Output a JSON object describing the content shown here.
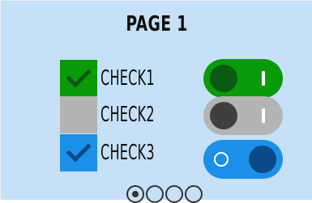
{
  "page": {
    "title": "PAGE 1"
  },
  "checks": [
    {
      "label": "CHECK1",
      "checked": true,
      "color": "#0a9a0a",
      "check_color": "#0a5a14"
    },
    {
      "label": "CHECK2",
      "checked": false,
      "color": "#b4b4b4"
    },
    {
      "label": "CHECK3",
      "checked": true,
      "color": "#1c8fe8",
      "check_color": "#0a4a88"
    }
  ],
  "toggles": [
    {
      "state": "off",
      "track_color": "#0a9a0a",
      "knob_color": "#0a5a14"
    },
    {
      "state": "off-disabled",
      "track_color": "#b4b4b4",
      "knob_color": "#3f3f3f"
    },
    {
      "state": "on",
      "track_color": "#1c8fe8",
      "knob_color": "#0a4a88"
    }
  ],
  "pagination": {
    "total_pages": 4,
    "current_page": 1
  },
  "colors": {
    "panel_background": "#c5e0f7",
    "text": "#111111"
  }
}
